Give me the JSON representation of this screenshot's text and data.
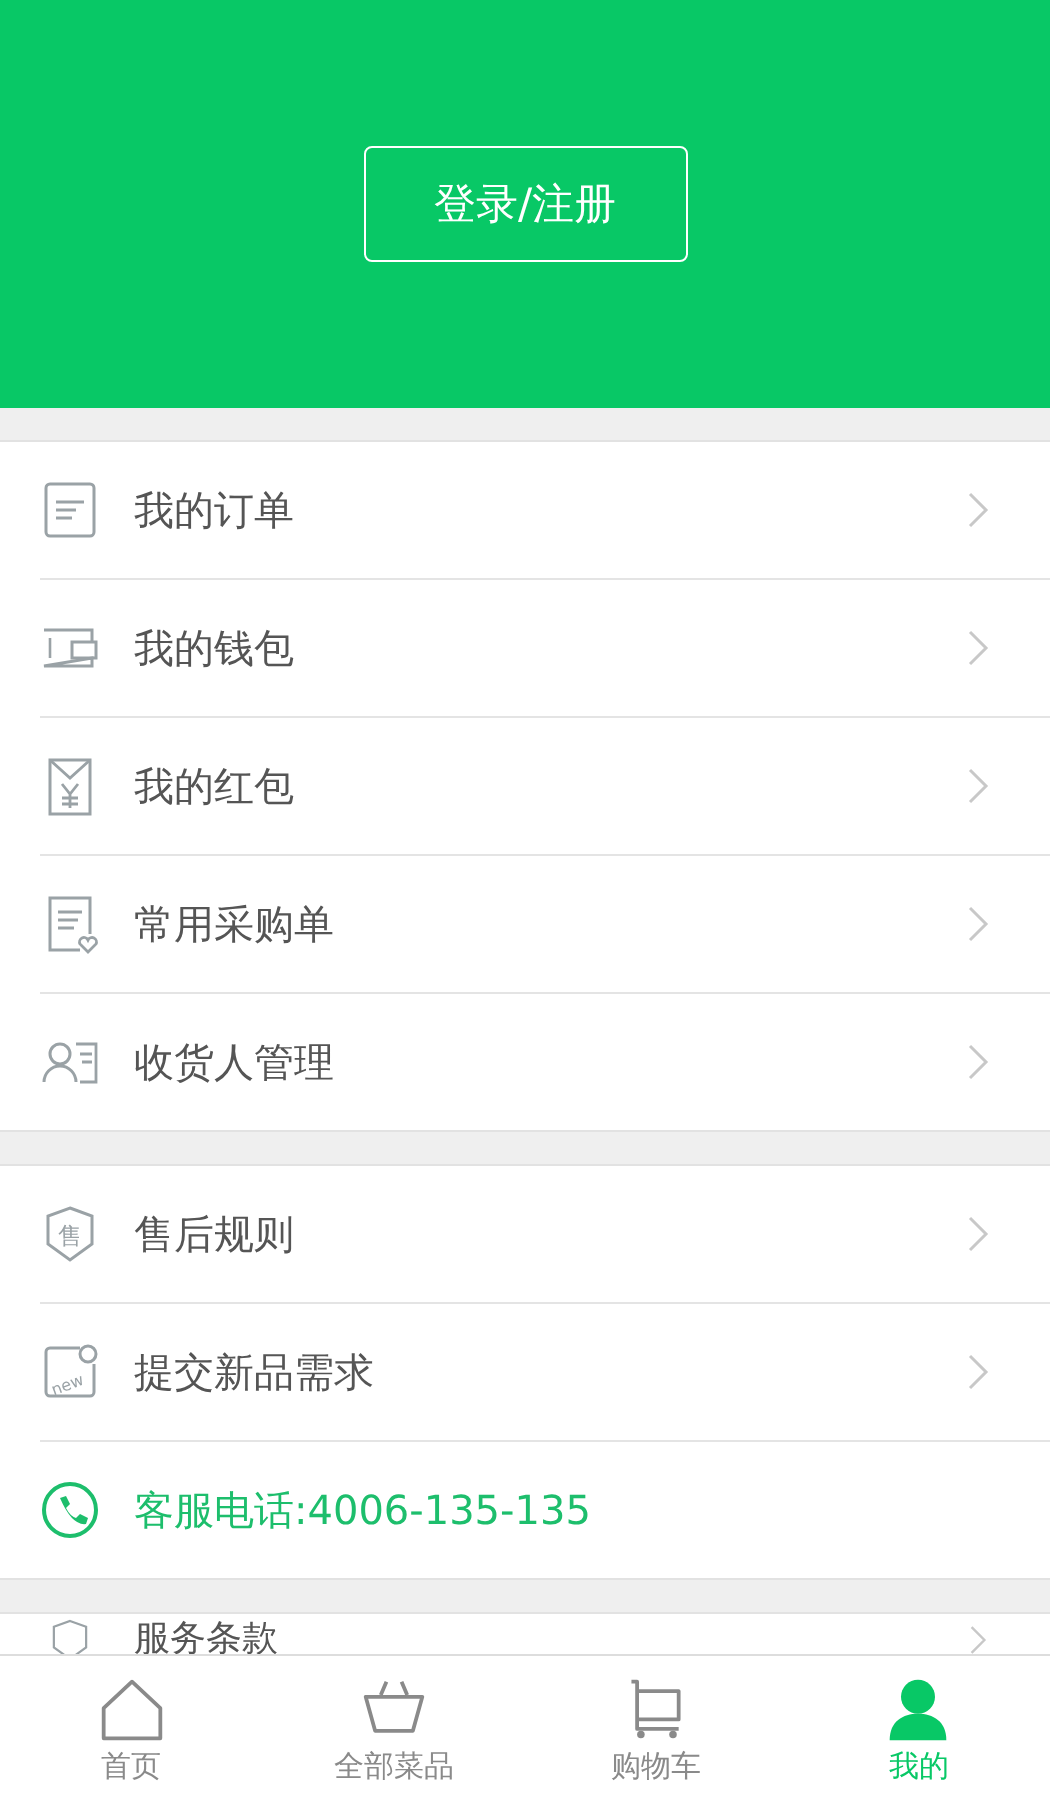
{
  "header": {
    "login_button": "登录/注册"
  },
  "groups": [
    {
      "items": [
        {
          "kind": "link",
          "label": "我的订单"
        },
        {
          "kind": "link",
          "label": "我的钱包"
        },
        {
          "kind": "link",
          "label": "我的红包"
        },
        {
          "kind": "link",
          "label": "常用采购单"
        },
        {
          "kind": "link",
          "label": "收货人管理"
        }
      ]
    },
    {
      "items": [
        {
          "kind": "link",
          "icon_text": "售",
          "label": "售后规则"
        },
        {
          "kind": "link",
          "icon_text": "new",
          "label": "提交新品需求"
        },
        {
          "kind": "phone",
          "label": "客服电话:4006-135-135"
        }
      ]
    },
    {
      "items": [
        {
          "kind": "link",
          "label": "服务条款"
        }
      ]
    }
  ],
  "tab_bar": [
    {
      "label": "首页",
      "selected": false
    },
    {
      "label": "全部菜品",
      "selected": false
    },
    {
      "label": "购物车",
      "selected": false
    },
    {
      "label": "我的",
      "selected": true
    }
  ]
}
